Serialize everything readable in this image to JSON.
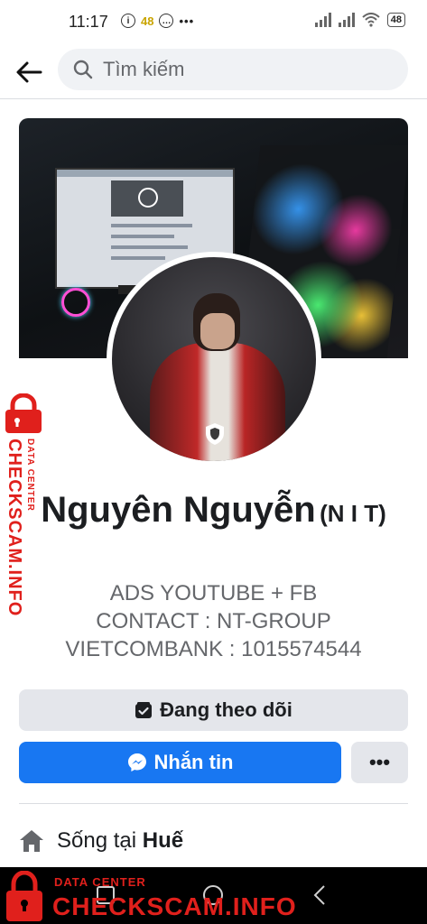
{
  "status_bar": {
    "time": "11:17",
    "notification_count": "48",
    "more_dots": "•••",
    "battery": "48"
  },
  "search": {
    "placeholder": "Tìm kiếm"
  },
  "profile": {
    "name_main": "Nguyên Nguyễn",
    "name_sub": "(N I T)",
    "bio_lines": [
      "ADS YOUTUBE + FB",
      "CONTACT : NT-GROUP",
      "VIETCOMBANK : 1015574544"
    ]
  },
  "actions": {
    "following_label": "Đang theo dõi",
    "message_label": "Nhắn tin",
    "more_label": "•••"
  },
  "details": {
    "lives_in_prefix": "Sống tại ",
    "lives_in_city": "Huế"
  },
  "watermark": {
    "small": "DATA CENTER",
    "big": "CHECKSCAM.INFO"
  },
  "colors": {
    "primary_blue": "#1877f2",
    "button_gray": "#e4e6eb",
    "secondary_text": "#65676b",
    "watermark_red": "#e0201c"
  }
}
